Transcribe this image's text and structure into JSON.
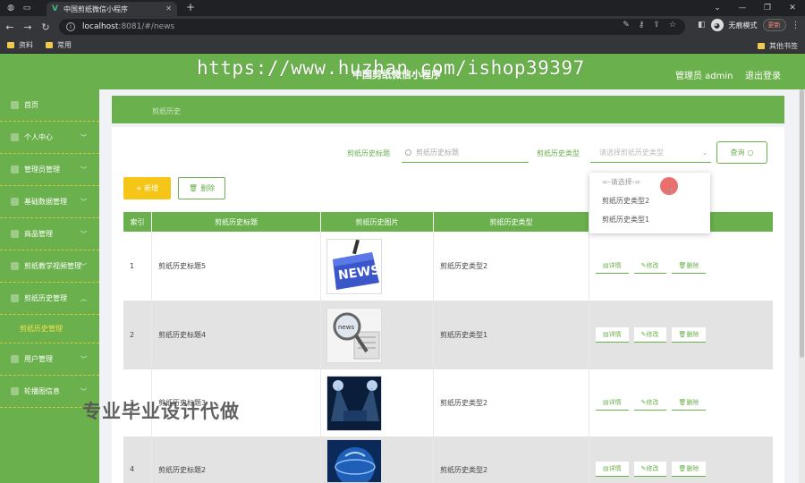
{
  "browser": {
    "tab_title": "中国剪纸微信小程序",
    "url_host": "localhost",
    "url_path": ":8081/#/news",
    "incognito_label": "无痕模式",
    "update_label": "更新",
    "bookmarks": [
      "资料",
      "常用"
    ],
    "other_bookmarks": "其他书签"
  },
  "app": {
    "title": "中国剪纸微信小程序",
    "user_label": "管理员 admin",
    "logout_label": "退出登录",
    "watermark_url": "https://www.huzhan.com/ishop39397",
    "watermark_ad": "专业毕业设计代做",
    "accent_color": "#6ab04c"
  },
  "sidebar": {
    "items": [
      {
        "label": "首页",
        "has_chevron": false
      },
      {
        "label": "个人中心",
        "has_chevron": true
      },
      {
        "label": "管理员管理",
        "has_chevron": true
      },
      {
        "label": "基础数据管理",
        "has_chevron": true
      },
      {
        "label": "商品管理",
        "has_chevron": true
      },
      {
        "label": "剪纸教学视频管理",
        "has_chevron": true
      },
      {
        "label": "剪纸历史管理",
        "has_chevron": true,
        "expanded": true
      },
      {
        "label": "剪纸历史管理",
        "sub": true
      },
      {
        "label": "用户管理",
        "has_chevron": true
      },
      {
        "label": "轮播图信息",
        "has_chevron": true
      }
    ]
  },
  "breadcrumb": "剪纸历史",
  "search": {
    "title_label": "剪纸历史标题",
    "title_placeholder": "剪纸历史标题",
    "type_label": "剪纸历史类型",
    "type_placeholder": "请选择剪纸历史类型",
    "query_button": "查询"
  },
  "toolbar": {
    "add_label": "+ 新增",
    "delete_label": "删除"
  },
  "dropdown": {
    "options": [
      "=-请选择-=",
      "剪纸历史类型2",
      "剪纸历史类型1"
    ]
  },
  "table": {
    "headers": [
      "索引",
      "剪纸历史标题",
      "剪纸历史图片",
      "剪纸历史类型",
      "操作"
    ],
    "rows": [
      {
        "index": "1",
        "title": "剪纸历史标题5",
        "type": "剪纸历史类型2",
        "image": "news-keyboard"
      },
      {
        "index": "2",
        "title": "剪纸历史标题4",
        "type": "剪纸历史类型1",
        "image": "news-magnifier"
      },
      {
        "index": "3",
        "title": "剪纸历史标题3",
        "type": "剪纸历史类型2",
        "image": "news-stage"
      },
      {
        "index": "4",
        "title": "剪纸历史标题2",
        "type": "剪纸历史类型2",
        "image": "news-globe"
      }
    ],
    "action_labels": {
      "detail": "详情",
      "edit": "修改",
      "delete": "删除"
    }
  }
}
